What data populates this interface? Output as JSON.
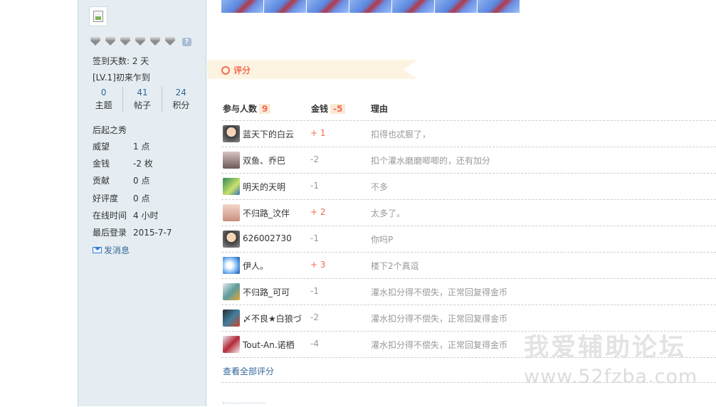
{
  "sidebar": {
    "checkin": "签到天数: 2 天",
    "level": "[LV.1]初来乍到",
    "stats": [
      {
        "num": "0",
        "label": "主题"
      },
      {
        "num": "41",
        "label": "帖子"
      },
      {
        "num": "24",
        "label": "积分"
      }
    ],
    "rank": "后起之秀",
    "details": [
      {
        "k": "威望",
        "v": "1 点"
      },
      {
        "k": "金钱",
        "v": "-2 枚"
      },
      {
        "k": "贡献",
        "v": "0 点"
      },
      {
        "k": "好评度",
        "v": "0 点"
      },
      {
        "k": "在线时间",
        "v": "4 小时"
      },
      {
        "k": "最后登录",
        "v": "2015-7-7"
      }
    ],
    "send_message": "发消息"
  },
  "rating": {
    "title": "评分",
    "participants_label": "参与人数",
    "participants_count": "9",
    "money_label": "金钱",
    "money_total": "-5",
    "reason_label": "理由",
    "rows": [
      {
        "name": "蓝天下的白云",
        "money": "+ 1",
        "reason": "扣得也忒狠了，"
      },
      {
        "name": "双鱼、乔巴",
        "money": "-2",
        "reason": "扣个灌水磨磨唧唧的，还有加分"
      },
      {
        "name": "明天的天明",
        "money": "-1",
        "reason": "不多"
      },
      {
        "name": "不归路_汶伴",
        "money": "+ 2",
        "reason": "太多了。"
      },
      {
        "name": "626002730",
        "money": "-1",
        "reason": "你吗P"
      },
      {
        "name": "伊人。",
        "money": "+ 3",
        "reason": "楼下2个真逗"
      },
      {
        "name": "不归路_可可",
        "money": "-1",
        "reason": "灌水扣分得不偿失，正常回复得金币"
      },
      {
        "name": "〆不良★白狼づ",
        "money": "-2",
        "reason": "灌水扣分得不偿失，正常回复得金币"
      },
      {
        "name": "Tout-An.诺栖",
        "money": "-4",
        "reason": "灌水扣分得不偿失，正常回复得金币"
      }
    ],
    "view_all": "查看全部评分"
  },
  "watermark": {
    "line1": "我爱辅助论坛",
    "line2": "www.52fzba.com"
  },
  "colors": {
    "sidebar_bg": "#e5edf2",
    "accent_orange": "#f26c4f",
    "link_blue": "#336699"
  }
}
